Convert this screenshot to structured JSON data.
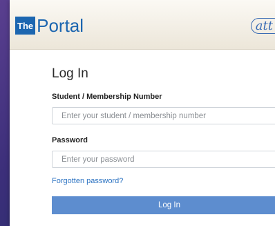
{
  "header": {
    "logo_box": "The",
    "logo_text": "Portal",
    "brand_right": "att"
  },
  "form": {
    "title": "Log In",
    "student_label": "Student / Membership Number",
    "student_placeholder": "Enter your student / membership number",
    "password_label": "Password",
    "password_placeholder": "Enter your password",
    "forgot_link": "Forgotten password?",
    "login_button": "Log In"
  },
  "colors": {
    "brand_blue": "#1c66b0",
    "button_blue": "#5d8dcf",
    "link_blue": "#2c73c2"
  }
}
